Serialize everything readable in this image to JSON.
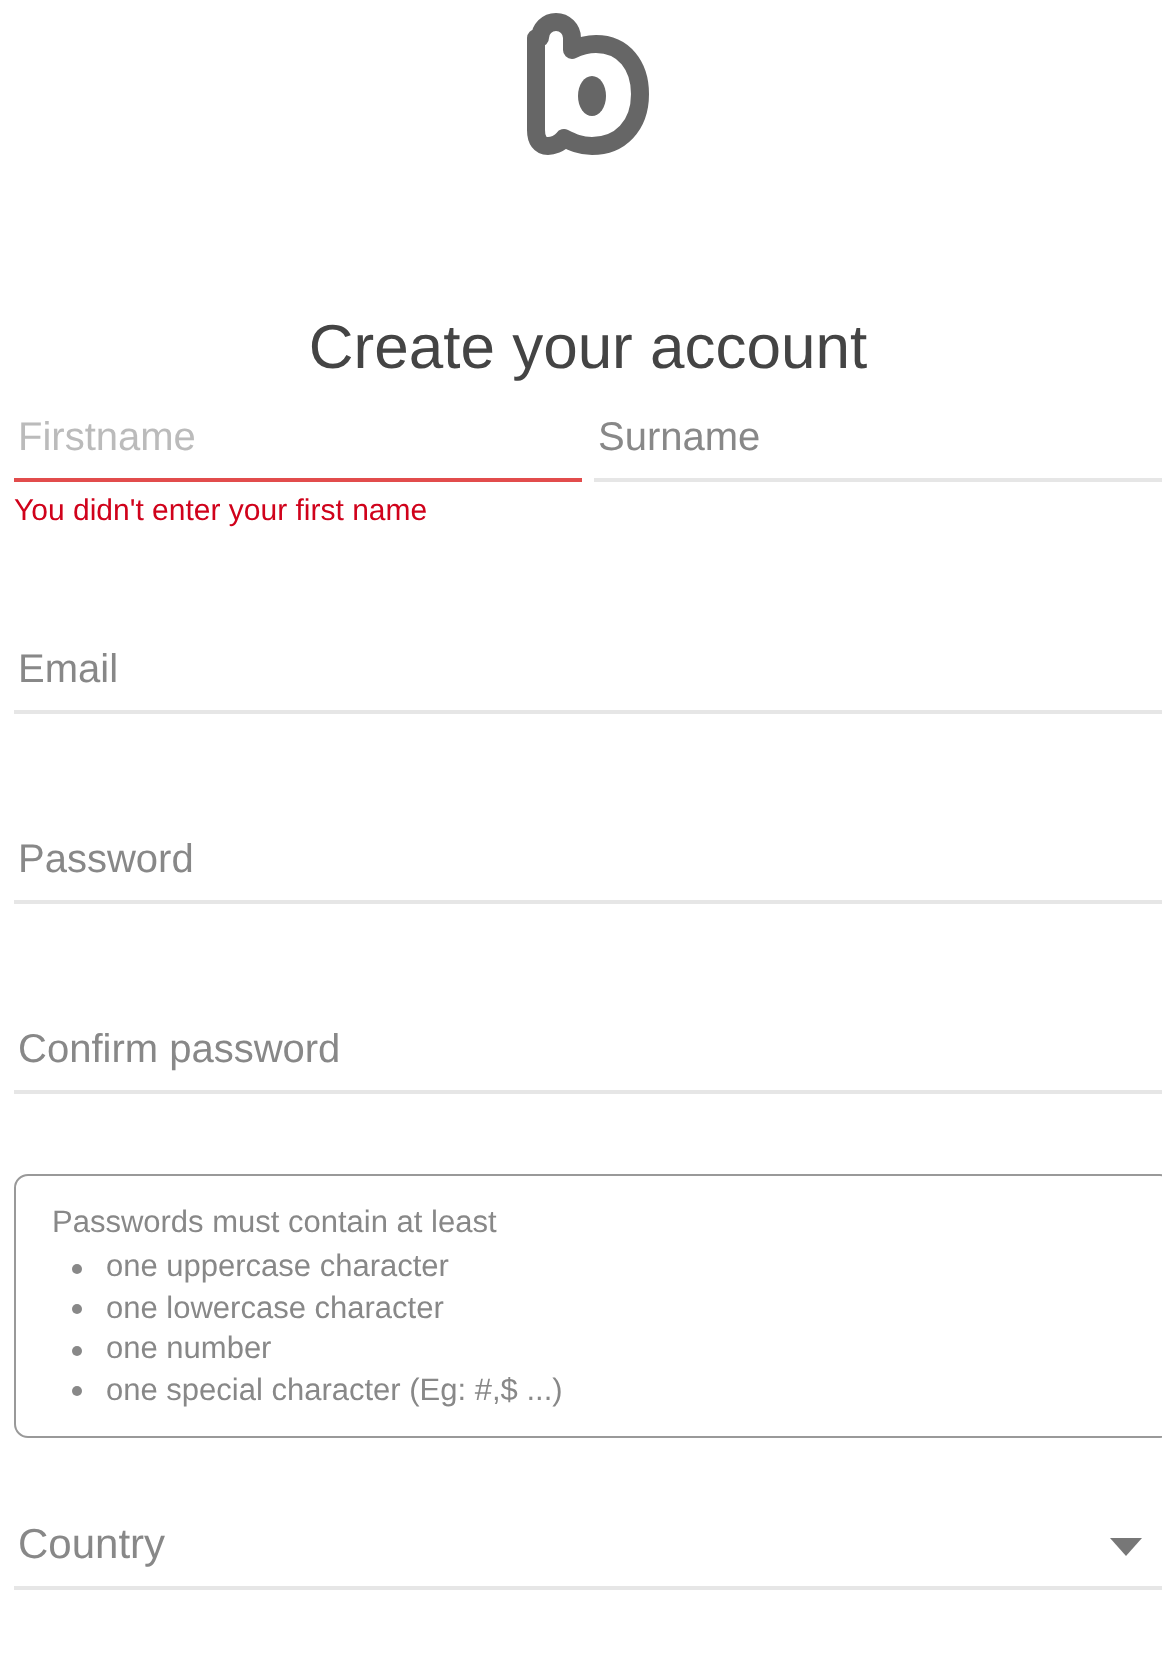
{
  "title": "Create your account",
  "name_fields": [
    {
      "placeholder": "Firstname",
      "error": true,
      "error_message": "You didn't enter your first name"
    },
    {
      "placeholder": "Surname",
      "error": false
    }
  ],
  "fields": [
    {
      "kind": "text",
      "placeholder": "Email"
    },
    {
      "kind": "text",
      "placeholder": "Password"
    },
    {
      "kind": "text",
      "placeholder": "Confirm password"
    }
  ],
  "password_rules": {
    "heading": "Passwords must contain at least",
    "items": [
      "one uppercase character",
      "one lowercase character",
      "one number",
      "one special character (Eg: #,$ ...)"
    ]
  },
  "country": {
    "kind": "select",
    "placeholder": "Country"
  }
}
